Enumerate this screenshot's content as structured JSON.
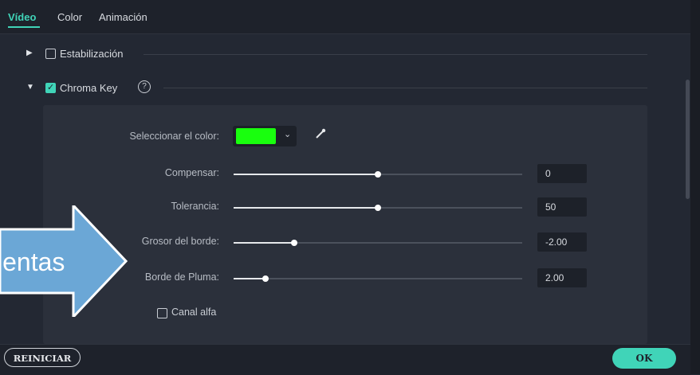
{
  "tabs": [
    {
      "label": "Vídeo",
      "active": true
    },
    {
      "label": "Color",
      "active": false
    },
    {
      "label": "Animación",
      "active": false
    }
  ],
  "sections": {
    "stabilization": {
      "label": "Estabilización",
      "expanded": false,
      "checked": false
    },
    "chroma_key": {
      "label": "Chroma Key",
      "expanded": true,
      "checked": true,
      "help": "?"
    }
  },
  "chroma": {
    "select_color_label": "Seleccionar el color:",
    "selected_color": "#19ff0e",
    "sliders": [
      {
        "label": "Compensar:",
        "value": "0",
        "fill": 0.5
      },
      {
        "label": "Tolerancia:",
        "value": "50",
        "fill": 0.5
      },
      {
        "label": "Grosor del borde:",
        "value": "-2.00",
        "fill": 0.21
      },
      {
        "label": "Borde de Pluma:",
        "value": "2.00",
        "fill": 0.11
      }
    ],
    "alpha_channel_label": "Canal alfa",
    "alpha_channel_checked": false
  },
  "footer": {
    "reset_label": "REINICIAR",
    "ok_label": "OK"
  },
  "overlay": {
    "text": "ientas"
  },
  "colors": {
    "accent": "#40d4b8",
    "background": "#232833",
    "panel": "#2b303b",
    "overlay_arrow": "#6ba7d6"
  }
}
